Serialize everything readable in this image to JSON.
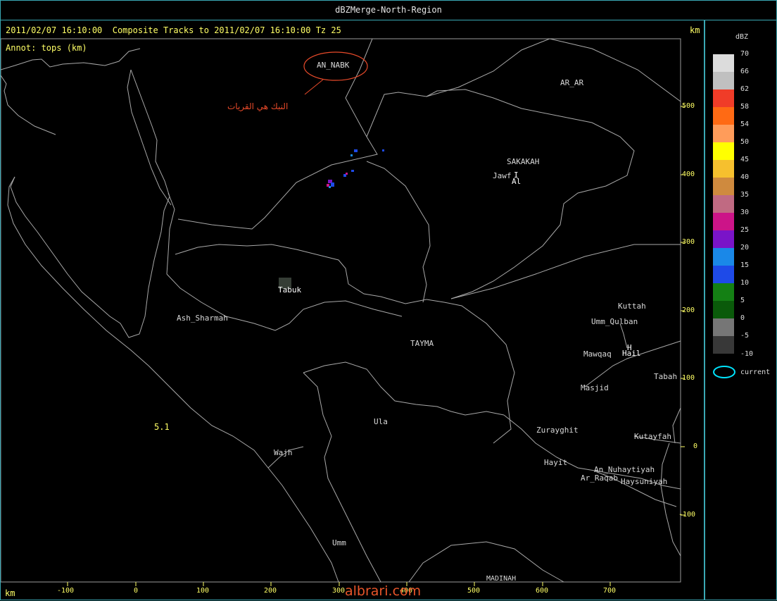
{
  "window": {
    "title": "dBZMerge-North-Region"
  },
  "header": {
    "line1": "2011/02/07 16:10:00  Composite Tracks to 2011/02/07 16:10:00 Tz 25",
    "line2": "Annot: tops (km)",
    "unit_top_right": "km",
    "unit_bottom_left": "km"
  },
  "axes": {
    "y_ticks": [
      "500",
      "400",
      "300",
      "200",
      "100",
      "0",
      "-100"
    ],
    "x_ticks": [
      "-100",
      "0",
      "100",
      "200",
      "300",
      "400",
      "500",
      "600",
      "700"
    ]
  },
  "annotation": {
    "circled_label": "AN_NABK",
    "arabic_note": "النبك هي القريات",
    "color": "#e84a2a"
  },
  "cities": {
    "ar_ar": "AR_AR",
    "sakakah": "SAKAKAH",
    "jawf": "Jawf",
    "al": "Al",
    "i_mark": "I",
    "tabuk": "Tabuk",
    "ash_sharmah": "Ash_Sharmah",
    "tayma": "TAYMA",
    "kuttah": "Kuttah",
    "umm_qulban": "Umm_Qulban",
    "mawqaq": "Mawqaq",
    "hail": "Hail",
    "h_mark": "H",
    "tabah": "Tabah",
    "masjid": "Masjid",
    "ula": "Ula",
    "zurayghit": "Zurayghit",
    "kutayfah": "Kutayfah",
    "wajh": "Wajh",
    "hayit": "Hayit",
    "an_nuhaytiyah": "An_Nuhaytiyah",
    "ar_raqab": "Ar_Raqab",
    "haysuniyah": "Haysuniyah",
    "umm": "Umm",
    "madinah": "MADINAH",
    "track_value": "5.1"
  },
  "legend": {
    "title": "dBZ",
    "items": [
      {
        "label": "70",
        "color": "#dcdcdc"
      },
      {
        "label": "66",
        "color": "#c0c0c0"
      },
      {
        "label": "62",
        "color": "#f03c28"
      },
      {
        "label": "58",
        "color": "#ff6a14"
      },
      {
        "label": "54",
        "color": "#ff9c5a"
      },
      {
        "label": "50",
        "color": "#ffff00"
      },
      {
        "label": "45",
        "color": "#f6c02e"
      },
      {
        "label": "40",
        "color": "#cf8a3e"
      },
      {
        "label": "35",
        "color": "#c06a82"
      },
      {
        "label": "30",
        "color": "#cc1488"
      },
      {
        "label": "25",
        "color": "#7a14c8"
      },
      {
        "label": "20",
        "color": "#1a88e8"
      },
      {
        "label": "15",
        "color": "#1e4ae8"
      },
      {
        "label": "10",
        "color": "#148014"
      },
      {
        "label": "5",
        "color": "#0a5a0a"
      },
      {
        "label": "0",
        "color": "#767676"
      },
      {
        "label": "-5",
        "color": "#383838"
      }
    ],
    "bottom_label": "-10",
    "current_label": "current",
    "current_color": "#00e5ff"
  },
  "watermark": "albrari.com"
}
